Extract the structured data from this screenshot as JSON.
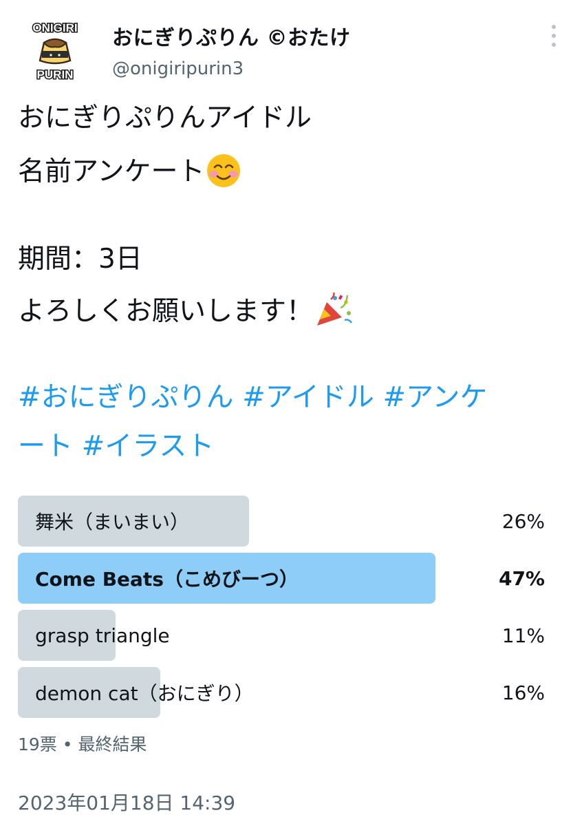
{
  "author": {
    "display_name": "おにぎりぷりん ©おたけ",
    "handle": "@onigiripurin3",
    "avatar_text_top": "ONIGIRI",
    "avatar_text_bottom": "PURIN"
  },
  "tweet": {
    "lines": [
      "おにぎりぷりんアイドル",
      "名前アンケート",
      "期間：3日",
      "よろしくお願いします！"
    ],
    "emojis": [
      "smiling-blush-emoji",
      "party-popper-emoji"
    ],
    "hashtags_line1": [
      "#おにぎりぷりん",
      "#アイドル",
      "#アンケ"
    ],
    "hashtags_line2": [
      "ート",
      "#イラスト"
    ]
  },
  "poll": {
    "options": [
      {
        "label": "舞米（まいまい）",
        "percent_text": "26%",
        "percent": 26
      },
      {
        "label": "Come Beats（こめびーつ）",
        "percent_text": "47%",
        "percent": 47,
        "winner": true
      },
      {
        "label": "grasp triangle",
        "percent_text": "11%",
        "percent": 11
      },
      {
        "label": "demon cat（おにぎり）",
        "percent_text": "16%",
        "percent": 16
      }
    ],
    "meta": "19票 • 最終結果"
  },
  "timestamp": "2023年01月18日 14:39",
  "colors": {
    "link": "#1d9bf0",
    "poll_bar": "#cfd9de",
    "poll_bar_winner": "#8ecdf8",
    "secondary_text": "#536471"
  },
  "icons": {
    "more": "more-vertical-icon"
  }
}
